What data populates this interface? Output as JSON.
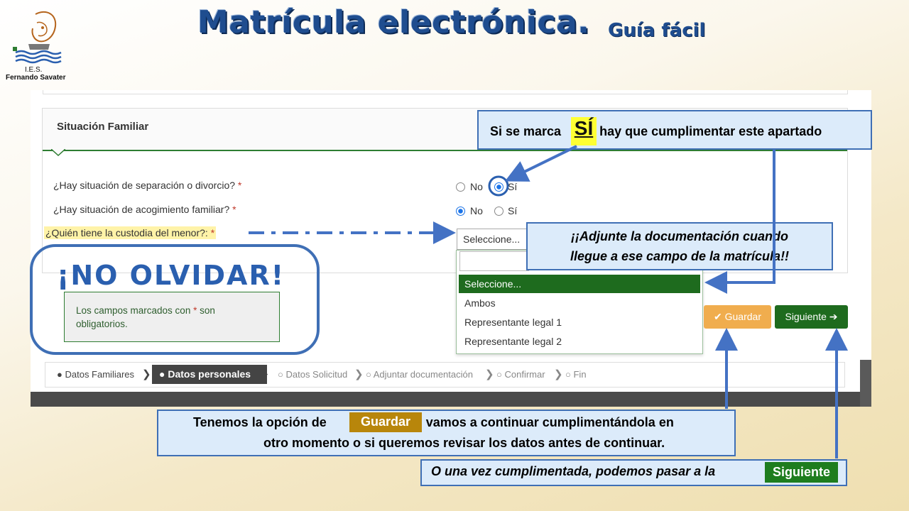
{
  "header": {
    "title": "Matrícula electrónica.",
    "subtitle": "Guía fácil",
    "logo_line1": "I.E.S.",
    "logo_line2": "Fernando Savater"
  },
  "form": {
    "section_title": "Situación Familiar",
    "questions": [
      {
        "label": "¿Hay situación de separación o divorcio?",
        "required_mark": "*",
        "options": [
          "No",
          "Sí"
        ],
        "selected": "Sí"
      },
      {
        "label": "¿Hay situación de acogimiento familiar?",
        "required_mark": "*",
        "options": [
          "No",
          "Sí"
        ],
        "selected": "No"
      },
      {
        "label": "¿Quién tiene la custodia del menor?:",
        "required_mark": "*"
      }
    ],
    "select_value": "Seleccione...",
    "dropdown_options": [
      "Seleccione...",
      "Ambos",
      "Representante legal 1",
      "Representante legal 2"
    ],
    "required_note_a": "Los campos marcados con",
    "required_note_star": "*",
    "required_note_b": "son",
    "required_note_c": "obligatorios.",
    "btn_guardar": "Guardar",
    "btn_siguiente": "Siguiente"
  },
  "steps": [
    {
      "label": "Datos Familiares",
      "state": "done"
    },
    {
      "label": "Datos personales",
      "state": "active"
    },
    {
      "label": "Datos Solicitud",
      "state": "pending"
    },
    {
      "label": "Adjuntar documentación",
      "state": "pending"
    },
    {
      "label": "Confirmar",
      "state": "pending"
    },
    {
      "label": "Fin",
      "state": "pending"
    }
  ],
  "callouts": {
    "marca_a": "Si se marca",
    "marca_si": "SÍ",
    "marca_b": "hay que cumplimentar este apartado",
    "adjunte_1": "¡¡Adjunte la documentación cuando",
    "adjunte_2": "llegue a ese campo de la matrícula!!",
    "no_olvidar": "¡NO OLVIDAR!",
    "opcion_a": "Tenemos la opción de",
    "opcion_tag": "Guardar",
    "opcion_b": "si vamos a continuar cumplimentándola en",
    "opcion_c": "otro momento o si queremos revisar los datos antes de continuar.",
    "siguiente_a": "O una vez cumplimentada, podemos pasar a la",
    "siguiente_tag": "Siguiente"
  },
  "colors": {
    "title_blue": "#1f4d8f",
    "accent_green": "#1e6b1e",
    "callout_border": "#3f6fb5",
    "guardar_orange": "#f0ad4e"
  }
}
